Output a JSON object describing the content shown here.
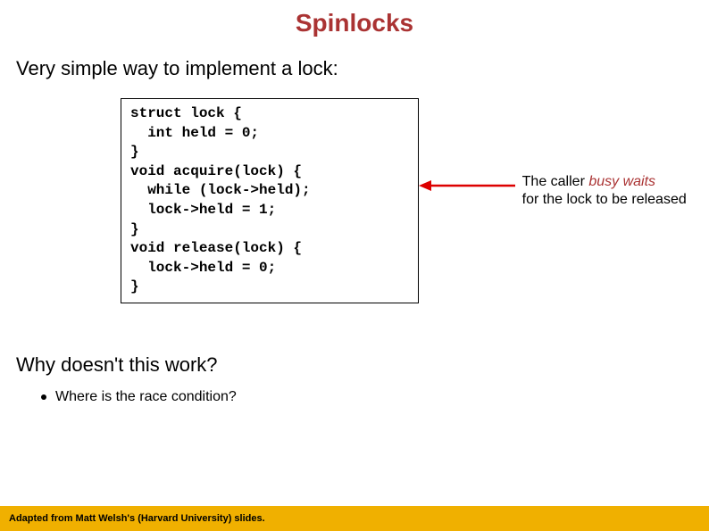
{
  "title": "Spinlocks",
  "intro": "Very simple way to implement a lock:",
  "code": "struct lock {\n  int held = 0;\n}\nvoid acquire(lock) {\n  while (lock->held);\n  lock->held = 1;\n}\nvoid release(lock) {\n  lock->held = 0;\n}",
  "annotation": {
    "pre": "The caller ",
    "em": "busy waits",
    "post": "for the lock to be released"
  },
  "question": "Why doesn't this work?",
  "bullet1": "Where is the race condition?",
  "footer": "Adapted from Matt Welsh's (Harvard University) slides."
}
